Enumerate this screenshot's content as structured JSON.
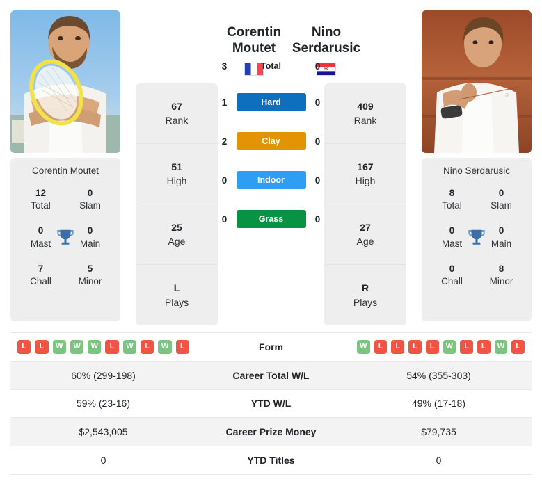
{
  "players": {
    "left": {
      "first_name": "Corentin",
      "last_name": "Moutet",
      "full_name": "Corentin Moutet",
      "country_flag": "france-flag",
      "photo_alt": "corentin-moutet-photo",
      "titles": {
        "total_value": "12",
        "total_label": "Total",
        "slam_value": "0",
        "slam_label": "Slam",
        "mast_value": "0",
        "mast_label": "Mast",
        "main_value": "0",
        "main_label": "Main",
        "chall_value": "7",
        "chall_label": "Chall",
        "minor_value": "5",
        "minor_label": "Minor"
      },
      "strip": [
        {
          "value": "67",
          "label": "Rank"
        },
        {
          "value": "51",
          "label": "High"
        },
        {
          "value": "25",
          "label": "Age"
        },
        {
          "value": "L",
          "label": "Plays"
        }
      ],
      "form": [
        "L",
        "L",
        "W",
        "W",
        "W",
        "L",
        "W",
        "L",
        "W",
        "L"
      ],
      "career_total_wl": "60% (299-198)",
      "ytd_wl": "59% (23-16)",
      "career_prize_money": "$2,543,005",
      "ytd_titles": "0"
    },
    "right": {
      "first_name": "Nino",
      "last_name": "Serdarusic",
      "full_name": "Nino Serdarusic",
      "country_flag": "croatia-flag",
      "photo_alt": "nino-serdarusic-photo",
      "titles": {
        "total_value": "8",
        "total_label": "Total",
        "slam_value": "0",
        "slam_label": "Slam",
        "mast_value": "0",
        "mast_label": "Mast",
        "main_value": "0",
        "main_label": "Main",
        "chall_value": "0",
        "chall_label": "Chall",
        "minor_value": "8",
        "minor_label": "Minor"
      },
      "strip": [
        {
          "value": "409",
          "label": "Rank"
        },
        {
          "value": "167",
          "label": "High"
        },
        {
          "value": "27",
          "label": "Age"
        },
        {
          "value": "R",
          "label": "Plays"
        }
      ],
      "form": [
        "W",
        "L",
        "L",
        "L",
        "L",
        "W",
        "L",
        "L",
        "W",
        "L"
      ],
      "career_total_wl": "54% (355-303)",
      "ytd_wl": "49% (17-18)",
      "career_prize_money": "$79,735",
      "ytd_titles": "0"
    }
  },
  "head_to_head": {
    "rows": [
      {
        "left": "3",
        "label": "Total",
        "right": "0",
        "badge": false,
        "color": ""
      },
      {
        "left": "1",
        "label": "Hard",
        "right": "0",
        "badge": true,
        "color": "#0d6fbd"
      },
      {
        "left": "2",
        "label": "Clay",
        "right": "0",
        "badge": true,
        "color": "#e39404"
      },
      {
        "left": "0",
        "label": "Indoor",
        "right": "0",
        "badge": true,
        "color": "#2e9ef4"
      },
      {
        "left": "0",
        "label": "Grass",
        "right": "0",
        "badge": true,
        "color": "#089243"
      }
    ]
  },
  "table": {
    "rows": [
      {
        "label": "Form",
        "type": "form"
      },
      {
        "label": "Career Total W/L",
        "type": "text",
        "key": "career_total_wl"
      },
      {
        "label": "YTD W/L",
        "type": "text",
        "key": "ytd_wl"
      },
      {
        "label": "Career Prize Money",
        "type": "text",
        "key": "career_prize_money"
      },
      {
        "label": "YTD Titles",
        "type": "text",
        "key": "ytd_titles"
      }
    ]
  },
  "colors": {
    "win_badge": "#7cc47f",
    "loss_badge": "#ee5543",
    "panel_bg": "#eeeeef",
    "row_shade": "#f3f3f4",
    "trophy": "#3c6fa8"
  }
}
